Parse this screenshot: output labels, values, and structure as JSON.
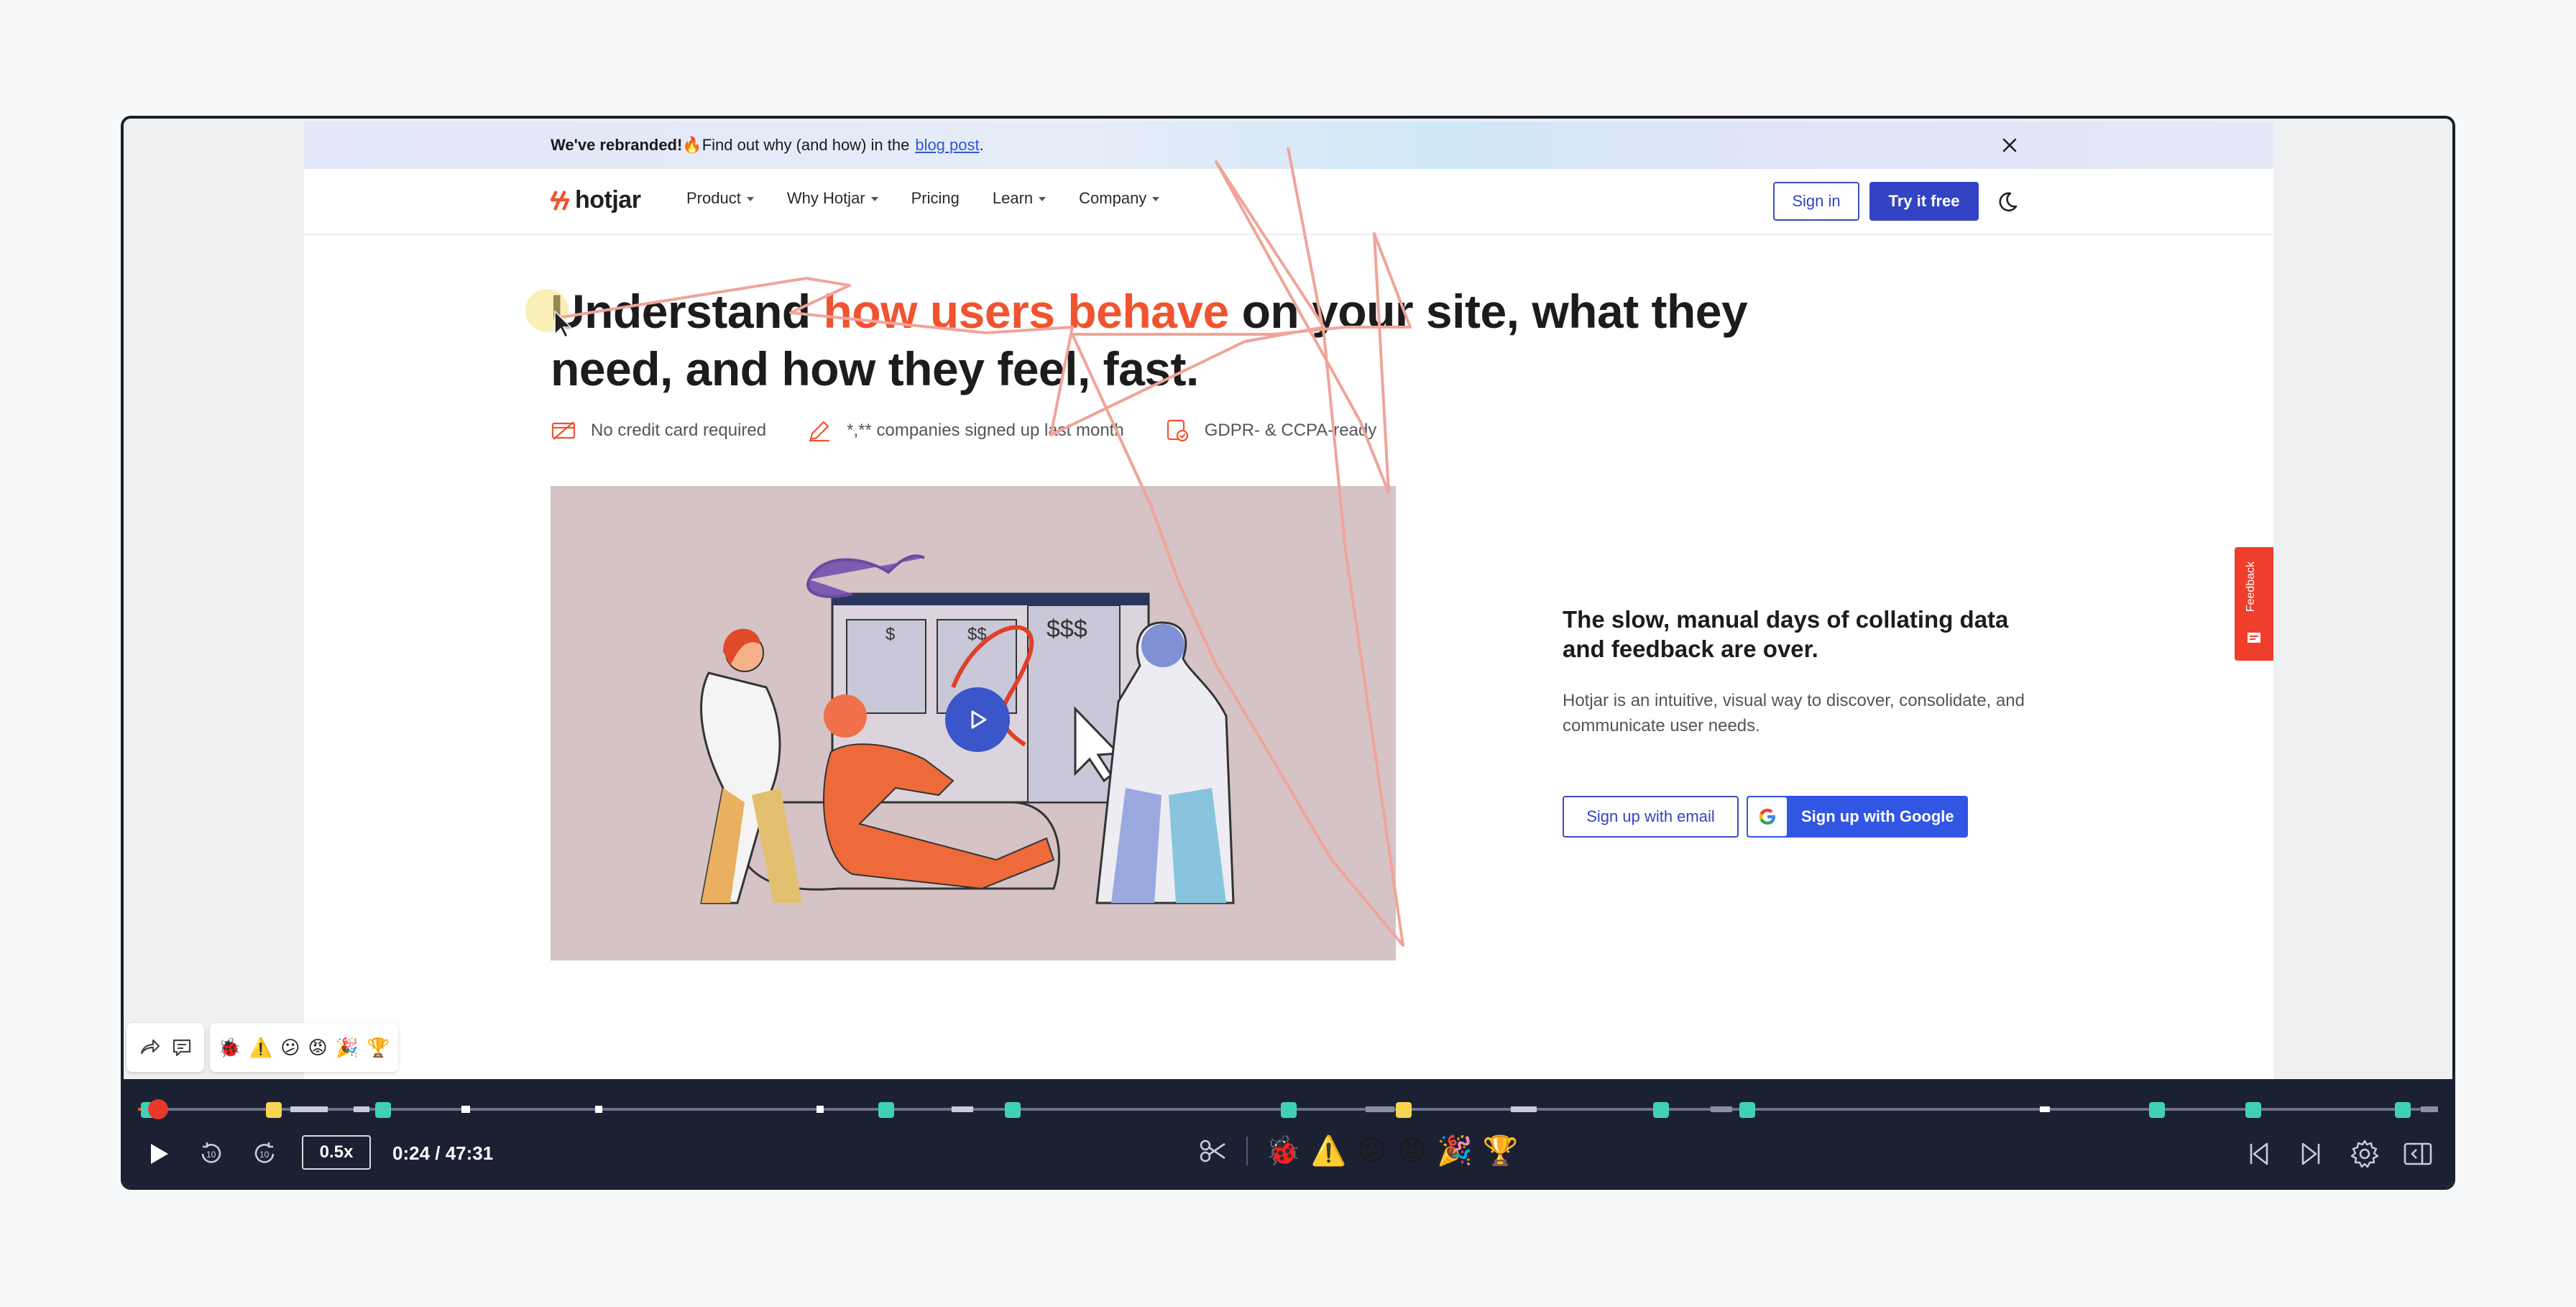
{
  "banner": {
    "bold": "We've rebranded!",
    "text": " 🔥Find out why (and how) in the",
    "link": "blog post",
    "period": "."
  },
  "nav": {
    "logo": "hotjar",
    "items": [
      {
        "label": "Product",
        "dropdown": true
      },
      {
        "label": "Why Hotjar",
        "dropdown": true
      },
      {
        "label": "Pricing",
        "dropdown": false
      },
      {
        "label": "Learn",
        "dropdown": true
      },
      {
        "label": "Company",
        "dropdown": true
      }
    ],
    "signin": "Sign in",
    "try": "Try it free"
  },
  "hero": {
    "title_pre": "Understand ",
    "title_accent": "how users behave",
    "title_post": " on your site, what they need, and how they feel, fast.",
    "badges": [
      {
        "icon": "credit-card-icon",
        "text": "No credit card required"
      },
      {
        "icon": "pencil-icon",
        "text": "*,** companies signed up last month"
      },
      {
        "icon": "shield-check-icon",
        "text": "GDPR- & CCPA-ready"
      }
    ]
  },
  "side": {
    "title": "The slow, manual days of collating data and feedback are over.",
    "body": "Hotjar is an intuitive, visual way to discover, consolidate, and communicate user needs.",
    "email_btn": "Sign up with email",
    "google_btn": "Sign up with Google"
  },
  "feedback_tab": "Feedback",
  "player": {
    "speed": "0.5x",
    "time": "0:24 / 47:31",
    "progress": 0.0084,
    "reactions": [
      "🐞",
      "⚠️",
      "😕",
      "😡",
      "🎉",
      "🏆"
    ],
    "accent": "#f0532f",
    "marker_color": "#3fd1b7"
  }
}
